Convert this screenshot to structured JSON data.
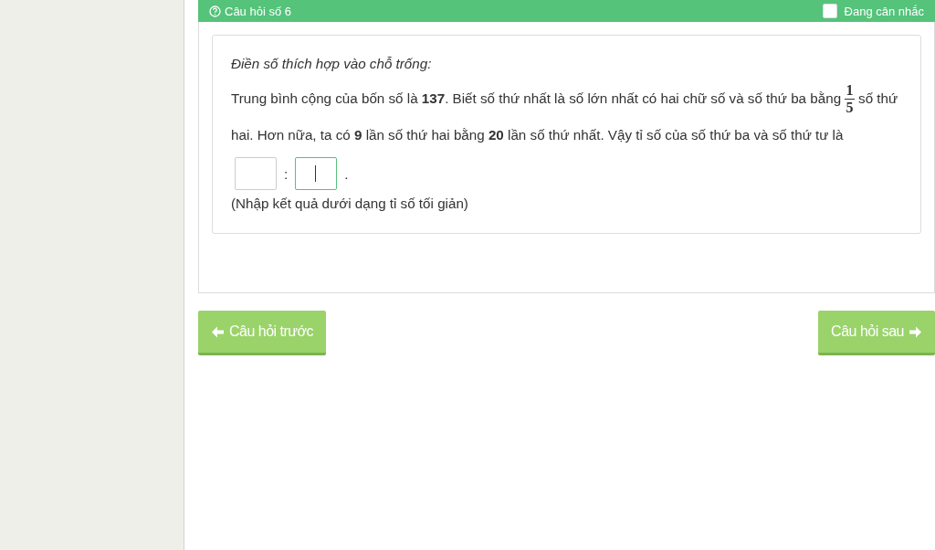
{
  "header": {
    "title": "Câu hỏi số 6",
    "flag": {
      "label": "Đang cân nhắc",
      "checked": false
    }
  },
  "question": {
    "instruction": "Điền số thích hợp vào chỗ trống:",
    "text_before": "Trung bình cộng của bốn số là **137**. Biết số thứ nhất là số lớn nhất có hai chữ số và số thứ ba bằng",
    "fraction": {
      "numerator": "1",
      "denominator": "5"
    },
    "text_after": "số thứ hai. Hơn nữa, ta có **9** lần số thứ hai bằng **20** lần số thứ nhất. Vậy tỉ số của số thứ ba và số thứ tư là",
    "answers": [
      {
        "focused": false
      },
      {
        "focused": true
      }
    ],
    "separator": ":",
    "end_mark": ".",
    "hint": "(Nhập kết quả dưới dạng tỉ số tối giản)"
  },
  "nav": {
    "previous": "Câu hỏi trước",
    "next": "Câu hỏi sau"
  }
}
